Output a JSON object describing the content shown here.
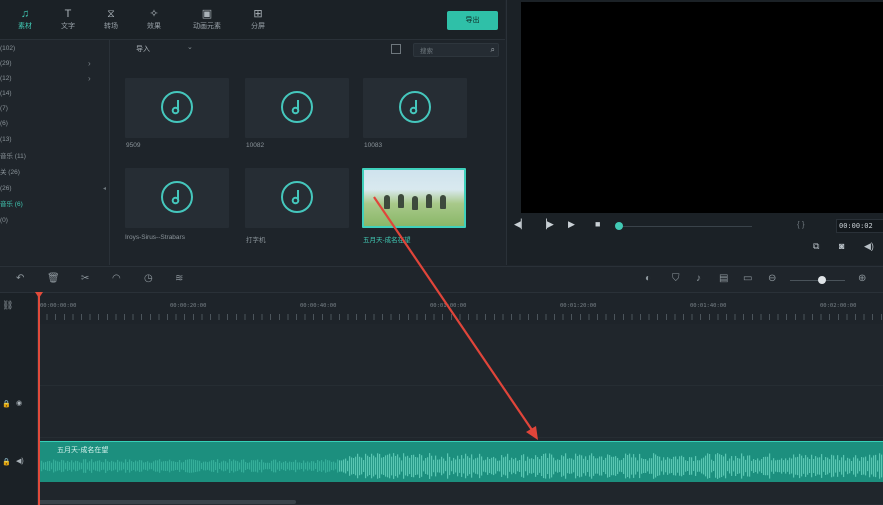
{
  "toolbar": {
    "tabs": [
      {
        "label": "素材",
        "icon": "music-note-icon"
      },
      {
        "label": "文字",
        "icon": "text-icon"
      },
      {
        "label": "转场",
        "icon": "transition-icon"
      },
      {
        "label": "效果",
        "icon": "effects-icon"
      },
      {
        "label": "动画元素",
        "icon": "elements-icon"
      },
      {
        "label": "分屏",
        "icon": "split-screen-icon"
      }
    ],
    "export_label": "导出"
  },
  "sidebar": {
    "items": [
      {
        "label": "(102)"
      },
      {
        "label": "(29)"
      },
      {
        "label": "(12)"
      },
      {
        "label": "(14)"
      },
      {
        "label": "(7)"
      },
      {
        "label": "(6)"
      },
      {
        "label": "(13)"
      },
      {
        "label": "音乐 (11)"
      },
      {
        "label": "关 (26)"
      },
      {
        "label": "(26)"
      },
      {
        "label": "音乐 (6)"
      },
      {
        "label": "(0)"
      }
    ]
  },
  "media": {
    "import_label": "导入",
    "search_placeholder": "搜索",
    "items": [
      {
        "label": "9509",
        "type": "audio"
      },
      {
        "label": "10082",
        "type": "audio"
      },
      {
        "label": "10083",
        "type": "audio"
      },
      {
        "label": "Iroys-Sirus--Strabars",
        "type": "audio"
      },
      {
        "label": "打字机",
        "type": "audio"
      },
      {
        "label": "五月天-成名在望",
        "type": "video",
        "selected": true
      }
    ]
  },
  "preview": {
    "timecode": "00:00:02"
  },
  "timeline": {
    "ruler_labels": [
      "00:00:00:00",
      "00:00:20:00",
      "00:00:40:00",
      "00:01:00:00",
      "00:01:20:00",
      "00:01:40:00",
      "00:02:00:00"
    ],
    "audio_clip_title": "五月天-成名在望"
  },
  "colors": {
    "accent": "#41c9b4",
    "audio_clip": "#1c8f7e",
    "playhead": "#e14b3b",
    "annotation_arrow": "#e0453a"
  }
}
